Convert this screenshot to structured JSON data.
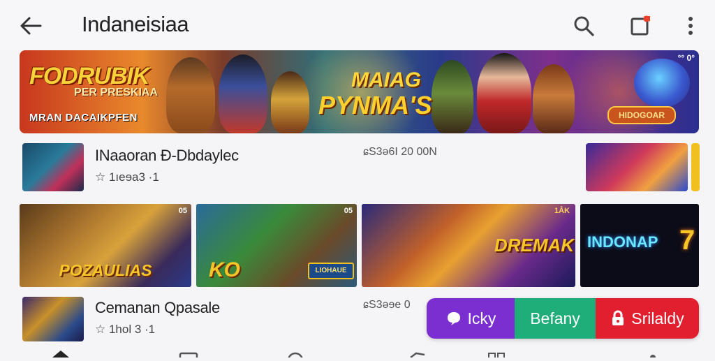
{
  "app": {
    "title": "Indaneisiaa",
    "back_icon": "arrow-left-icon",
    "actions": [
      {
        "name": "search-icon"
      },
      {
        "name": "notification-icon",
        "badge_color": "#e8412b"
      },
      {
        "name": "more-vert-icon"
      }
    ]
  },
  "banner": {
    "left_title": "FODRUBIK",
    "left_subtitle": "PER PRESKIAA",
    "left_tagline": "MRAN DACAIKPFEN",
    "center_line1": "MAIAG",
    "center_line2": "PYNMA'S",
    "cta_label": "HIDOGOAR",
    "corner_text": "°° 0°"
  },
  "featured_rows": [
    {
      "title": "INaaoran Ð-Dbdaylec",
      "meta": "☆ 1ıeɘa3 ·1",
      "extra": "ɕS3ǝ6I 20 00N"
    },
    {
      "title": "Cemanan Qpasale",
      "meta": "☆ 1hol 3 ·1",
      "extra": "ɕS3ǝɘe 0"
    }
  ],
  "tiles": [
    {
      "label": "POZAULIAS",
      "corner": "05"
    },
    {
      "label": "KO",
      "badge": "LIOHAUE",
      "corner": "05"
    },
    {
      "label": "DREMAK",
      "corner": "1ÅK"
    },
    {
      "label": "INDONAP",
      "badge": "7"
    }
  ],
  "chips": [
    {
      "label": "Icky",
      "color": "#7b2fd0",
      "icon": "chat-bubble-icon"
    },
    {
      "label": "Befany",
      "color": "#1fae7a"
    },
    {
      "label": "Srilaldy",
      "color": "#e21f2f",
      "icon": "lock-icon"
    }
  ],
  "bottom_nav": [
    {
      "icon": "home-icon"
    },
    {
      "icon": "library-icon"
    },
    {
      "icon": "clock-icon"
    },
    {
      "icon": "tag-icon"
    },
    {
      "icon": "grid-icon"
    },
    {
      "icon": "person-icon"
    }
  ]
}
